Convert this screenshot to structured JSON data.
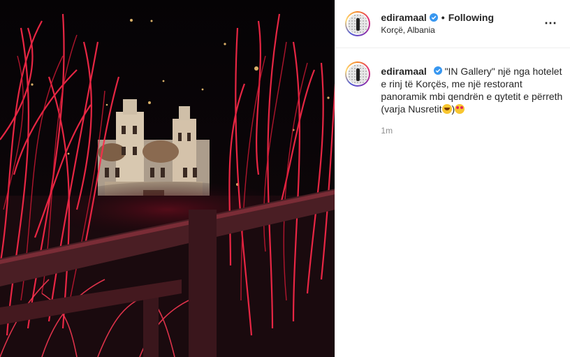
{
  "post": {
    "username": "ediramaal",
    "follow_status": "Following",
    "separator": "•",
    "location": "Korçë, Albania",
    "more_icon": "⋯"
  },
  "caption": {
    "username": "ediramaal",
    "text_main": "\"IN Gallery\" një nga hotelet e rinj të Korçës, me një restorant panoramik mbi qendrën e qytetit e përreth (varja Nusretit",
    "text_close": ")",
    "emojis": [
      "laughing-face",
      "heart-eyes-face"
    ],
    "time": "1m"
  },
  "colors": {
    "verified": "#3897f0",
    "light_red": "#ff2a4a",
    "text": "#262626",
    "muted": "#8e8e8e"
  },
  "media": {
    "subject": "night photo: cathedral behind red-lit grass and wooden railing"
  }
}
